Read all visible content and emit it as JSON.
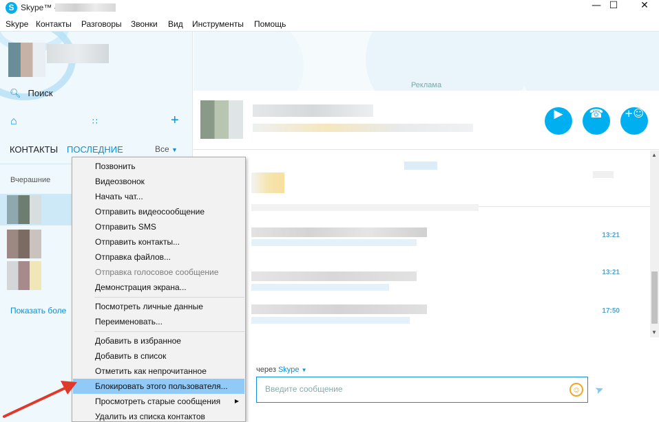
{
  "window": {
    "logo_letter": "S",
    "title": "Skype™ -",
    "minimize": "—",
    "maximize": "☐",
    "close": "✕"
  },
  "menubar": {
    "items": [
      "Skype",
      "Контакты",
      "Разговоры",
      "Звонки",
      "Вид",
      "Инструменты",
      "Помощь"
    ]
  },
  "sidebar": {
    "search_label": "Поиск",
    "search_icon": "search-icon",
    "home_icon": "home-icon",
    "dialpad_icon": "dialpad-icon",
    "add_icon": "plus-icon",
    "tab_contacts": "КОНТАКТЫ",
    "tab_recent": "ПОСЛЕДНИЕ",
    "filter_label": "Все",
    "section_yesterday": "Вчерашние",
    "show_more": "Показать боле"
  },
  "chat": {
    "ad_label": "Реклама",
    "video_call_icon": "video-camera-icon",
    "call_icon": "phone-icon",
    "add_contact_icon": "add-person-icon",
    "message_times": [
      "13:21",
      "13:21",
      "17:50"
    ],
    "via_prefix": "через",
    "via_service": "Skype",
    "compose_placeholder": "Введите сообщение",
    "emoji_icon": "smiley-icon",
    "send_icon": "send-icon"
  },
  "context_menu": {
    "items": [
      {
        "label": "Позвонить",
        "disabled": false
      },
      {
        "label": "Видеозвонок",
        "disabled": false
      },
      {
        "label": "Начать чат...",
        "disabled": false
      },
      {
        "label": "Отправить видеосообщение",
        "disabled": false
      },
      {
        "label": "Отправить SMS",
        "disabled": false
      },
      {
        "label": "Отправить контакты...",
        "disabled": false
      },
      {
        "label": "Отправка файлов...",
        "disabled": false
      },
      {
        "label": "Отправка голосовое сообщение",
        "disabled": true
      },
      {
        "label": "Демонстрация экрана...",
        "disabled": false
      },
      {
        "label": "Посмотреть личные данные",
        "disabled": false
      },
      {
        "label": "Переименовать...",
        "disabled": false
      },
      {
        "label": "Добавить в избранное",
        "disabled": false
      },
      {
        "label": "Добавить в список",
        "disabled": false
      },
      {
        "label": "Отметить как непрочитанное",
        "disabled": false
      },
      {
        "label": "Блокировать этого пользователя...",
        "disabled": false,
        "highlighted": true
      },
      {
        "label": "Просмотреть старые сообщения",
        "disabled": false,
        "submenu": true
      },
      {
        "label": "Удалить из списка контактов",
        "disabled": false
      }
    ]
  },
  "colors": {
    "accent": "#00aff0",
    "link": "#0c8fd6",
    "menu_highlight": "#91c9f7",
    "annotation_arrow": "#e0392b"
  }
}
